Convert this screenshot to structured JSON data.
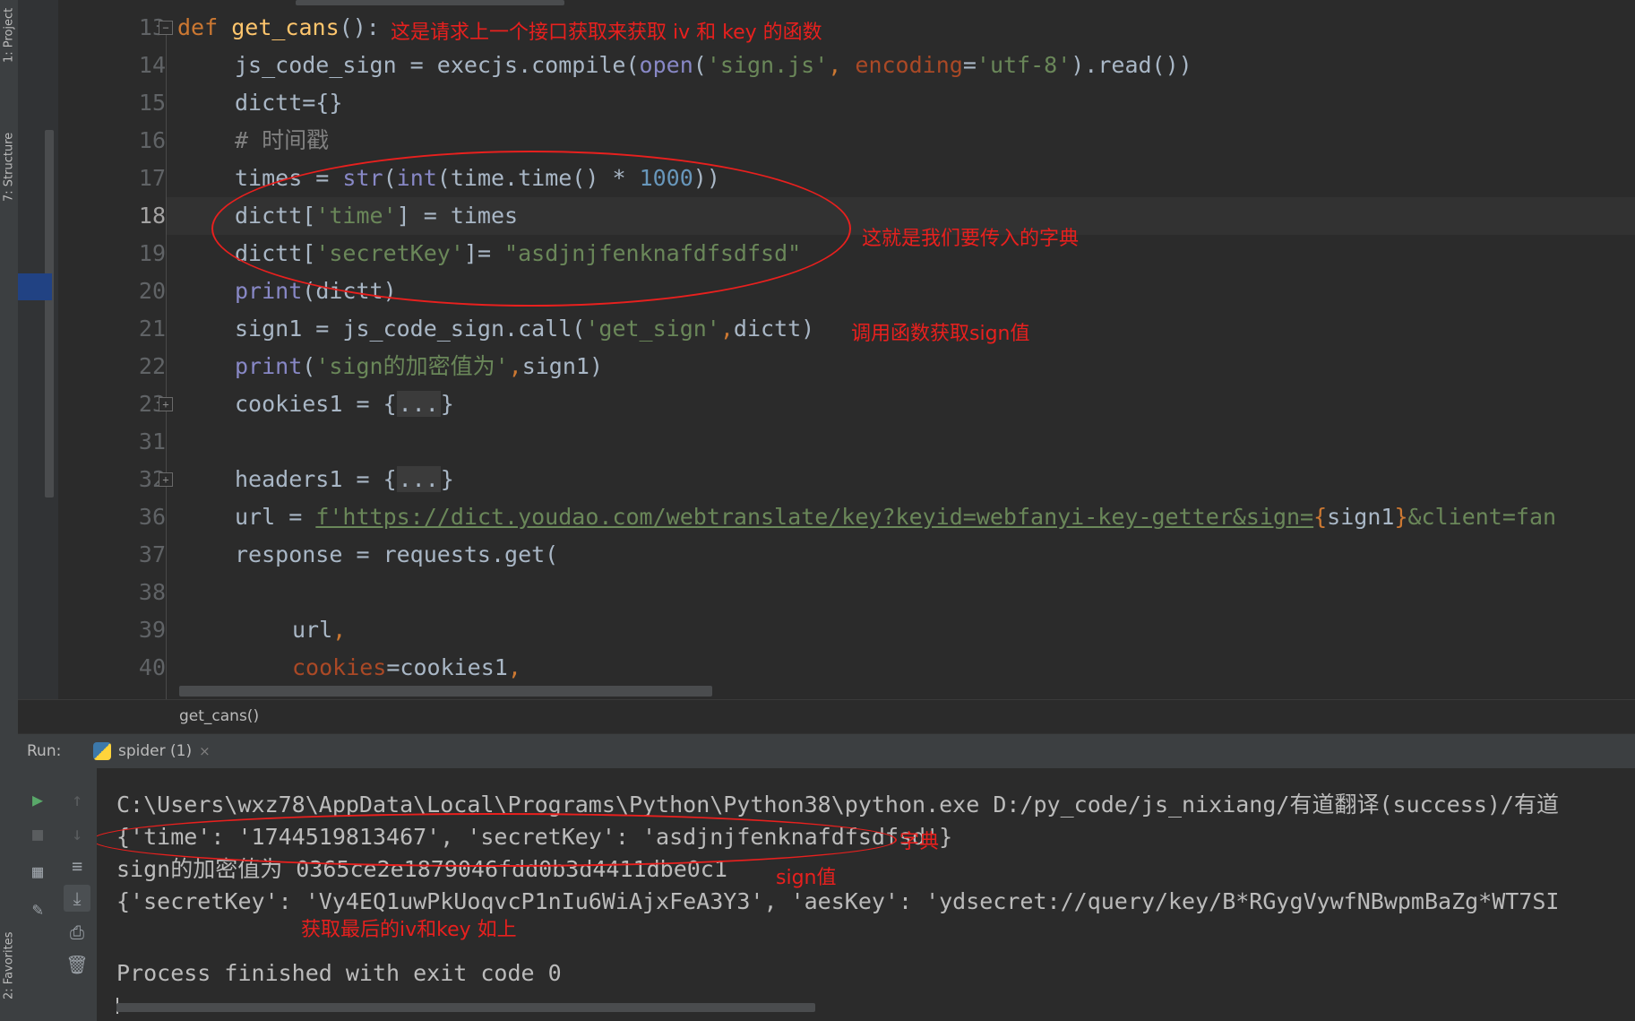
{
  "side_tabs": {
    "project": "1: Project",
    "structure": "7: Structure",
    "favorites": "2: Favorites"
  },
  "line_numbers": [
    "13",
    "14",
    "15",
    "16",
    "17",
    "18",
    "19",
    "20",
    "21",
    "22",
    "23",
    "31",
    "32",
    "36",
    "37",
    "38",
    "39",
    "40"
  ],
  "code": {
    "l13": {
      "kw": "def ",
      "fn": "get_cans",
      "rest": "():"
    },
    "l14": {
      "a": "js_code_sign = execjs.compile(",
      "b": "open",
      "c": "(",
      "d": "'sign.js'",
      "e": ", ",
      "f": "encoding",
      "g": "=",
      "h": "'utf-8'",
      "i": ").read())"
    },
    "l15": "dictt={}",
    "l16": "# 时间戳",
    "l17": {
      "a": "times = ",
      "b": "str",
      "c": "(",
      "d": "int",
      "e": "(time.time() * ",
      "f": "1000",
      "g": "))"
    },
    "l18": {
      "a": "dictt[",
      "b": "'time'",
      "c": "] = times"
    },
    "l19": {
      "a": "dictt[",
      "b": "'secretKey'",
      "c": "]= ",
      "d": "\"asdjnjfenknafdfsdfsd\""
    },
    "l20": {
      "a": "print",
      "b": "(dictt)"
    },
    "l21": {
      "a": "sign1 = js_code_sign.call(",
      "b": "'get_sign'",
      "c": ",",
      "d": "dictt)"
    },
    "l22": {
      "a": "print",
      "b": "(",
      "c": "'sign的加密值为'",
      "d": ",",
      "e": "sign1)"
    },
    "l23": {
      "a": "cookies1 = {",
      "b": "...",
      "c": "}"
    },
    "l32": {
      "a": "headers1 = {",
      "b": "...",
      "c": "}"
    },
    "l36": {
      "a": "url = ",
      "b": "f'https://dict.youdao.com/webtranslate/key?keyid=webfanyi-key-getter&sign=",
      "c": "{",
      "d": "sign1",
      "e": "}",
      "f": "&client=fan"
    },
    "l37": "response = requests.get(",
    "l39": {
      "a": "url",
      "b": ","
    },
    "l40": {
      "a": "cookies",
      "b": "=cookies1",
      "c": ","
    }
  },
  "annotations": {
    "a1": "这是请求上一个接口获取来获取 iv 和 key 的函数",
    "a2": "这就是我们要传入的字典",
    "a3": "调用函数获取sign值",
    "a4": "字典",
    "a5": "sign值",
    "a6": "获取最后的iv和key 如上"
  },
  "breadcrumb": "get_cans()",
  "run": {
    "label": "Run:",
    "tab": "spider (1)",
    "close": "×"
  },
  "console": {
    "c1": "C:\\Users\\wxz78\\AppData\\Local\\Programs\\Python\\Python38\\python.exe D:/py_code/js_nixiang/有道翻译(success)/有道",
    "c2": "{'time': '1744519813467', 'secretKey': 'asdjnjfenknafdfsdfsd'}",
    "c3": "sign的加密值为 0365ce2e1879046fdd0b3d4411dbe0c1",
    "c4": "{'secretKey': 'Vy4EQ1uwPkUoqvcP1nIu6WiAjxFeA3Y3', 'aesKey': 'ydsecret://query/key/B*RGygVywfNBwpmBaZg*WT7SI",
    "c5": "Process finished with exit code 0"
  },
  "colors": {
    "accent": "#e8201e",
    "keyword": "#cc7832",
    "string": "#6a8759",
    "number": "#6897bb",
    "function": "#ffc66d"
  },
  "icons": [
    "run-icon",
    "stop-icon",
    "up-arrow-icon",
    "down-arrow-icon",
    "soft-wrap-icon",
    "scroll-to-end-icon",
    "print-icon",
    "trash-icon",
    "layout-icon",
    "pin-icon",
    "python-icon",
    "close-icon",
    "fold-icon"
  ]
}
